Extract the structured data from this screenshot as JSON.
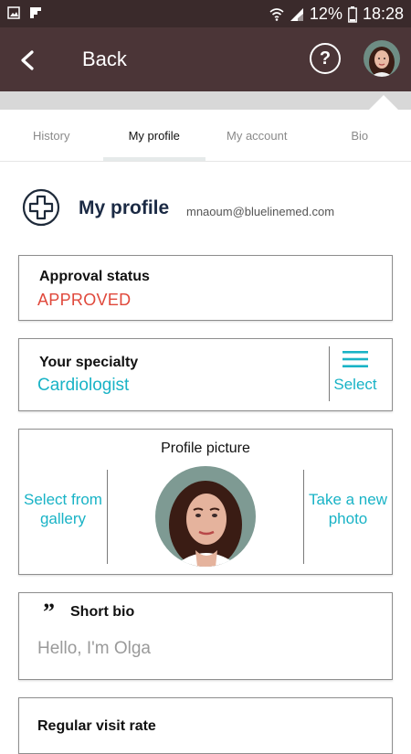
{
  "status_bar": {
    "battery": "12%",
    "time": "18:28"
  },
  "app_bar": {
    "back_label": "Back",
    "help_glyph": "?"
  },
  "tabs": [
    {
      "label": "History",
      "active": false
    },
    {
      "label": "My profile",
      "active": true
    },
    {
      "label": "My account",
      "active": false
    },
    {
      "label": "Bio",
      "active": false
    }
  ],
  "profile": {
    "title": "My profile",
    "email": "mnaoum@bluelinemed.com"
  },
  "approval": {
    "label": "Approval status",
    "value": "APPROVED"
  },
  "specialty": {
    "label": "Your specialty",
    "value": "Cardiologist",
    "select_label": "Select"
  },
  "picture": {
    "title": "Profile picture",
    "gallery_button": "Select from gallery",
    "photo_button": "Take a new photo"
  },
  "bio": {
    "label": "Short bio",
    "text": "Hello,  I'm Olga"
  },
  "visit_rate": {
    "label": "Regular visit rate"
  },
  "colors": {
    "accent": "#19b3c6",
    "approved": "#e0483b",
    "app_bar": "#4b3537",
    "status_bar": "#3a2a2b"
  }
}
